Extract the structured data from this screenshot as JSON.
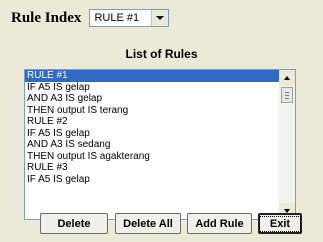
{
  "header": {
    "rule_index_label": "Rule Index",
    "rule_index_value": "RULE #1"
  },
  "list": {
    "title": "List of Rules",
    "items": [
      "RULE #1",
      "IF A5 IS gelap",
      "AND A3 IS gelap",
      "THEN output IS terang",
      "RULE #2",
      "IF A5 IS gelap",
      "AND A3 IS sedang",
      "THEN output IS agakterang",
      "RULE #3",
      "IF A5 IS gelap"
    ],
    "selected_index": 0
  },
  "buttons": {
    "delete": "Delete",
    "delete_all": "Delete All",
    "add_rule": "Add Rule",
    "exit": "Exit"
  },
  "colors": {
    "selection": "#316ac5",
    "panel_bg": "#ece9d8"
  }
}
